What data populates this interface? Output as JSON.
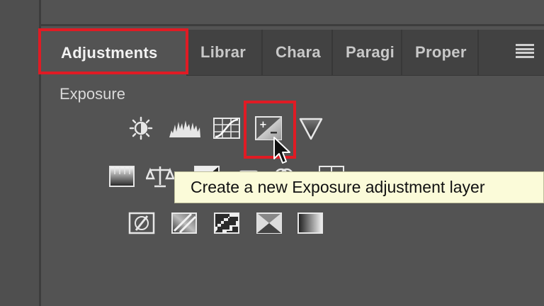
{
  "tabs": [
    {
      "label": "Adjustments",
      "active": true
    },
    {
      "label": "Librar"
    },
    {
      "label": "Chara"
    },
    {
      "label": "Paragi"
    },
    {
      "label": "Proper"
    }
  ],
  "section": {
    "title": "Exposure"
  },
  "tooltip": {
    "text": "Create a new Exposure adjustment layer"
  },
  "icons": {
    "row1": [
      "brightness-contrast-icon",
      "levels-icon",
      "curves-icon",
      "exposure-icon",
      "vibrance-icon"
    ],
    "row2": [
      "hue-saturation-icon",
      "color-balance-icon",
      "black-white-icon",
      "photo-filter-icon",
      "channel-mixer-icon",
      "color-lookup-icon"
    ],
    "row3": [
      "invert-icon",
      "posterize-icon",
      "threshold-icon",
      "selective-color-icon",
      "gradient-map-icon"
    ]
  },
  "colors": {
    "highlight": "#e01b24",
    "tooltip_bg": "#fbfbd9",
    "panel_bg": "#535353",
    "tabbar_bg": "#424242"
  }
}
